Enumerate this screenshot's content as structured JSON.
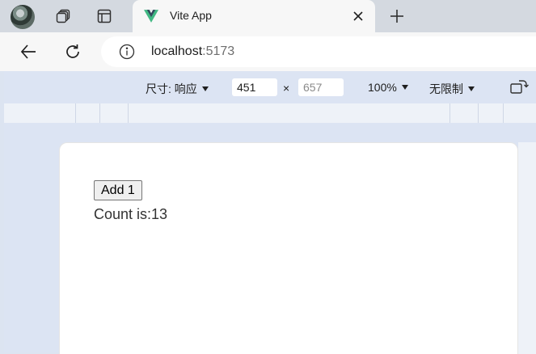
{
  "tabstrip": {
    "active_tab": {
      "title": "Vite App",
      "favicon": "vue-logo-icon"
    },
    "icons": [
      "avatar",
      "workspaces-icon",
      "tab-actions-icon",
      "close-icon",
      "plus-icon"
    ]
  },
  "toolbar": {
    "url_host": "localhost",
    "url_port": ":5173"
  },
  "device_toolbar": {
    "dimensions_label": "尺寸: 响应",
    "width": "451",
    "height_placeholder": "657",
    "times": "×",
    "zoom": "100%",
    "throttle": "无限制"
  },
  "app": {
    "button_label": "Add 1",
    "count_label": "Count is:",
    "count_value": "13"
  },
  "colors": {
    "tabstrip": "#d4d9e0",
    "toolbar": "#f7f7f7",
    "devtools_bg": "#dce4f3",
    "vue_green": "#41b883",
    "vue_dark": "#35495e"
  }
}
